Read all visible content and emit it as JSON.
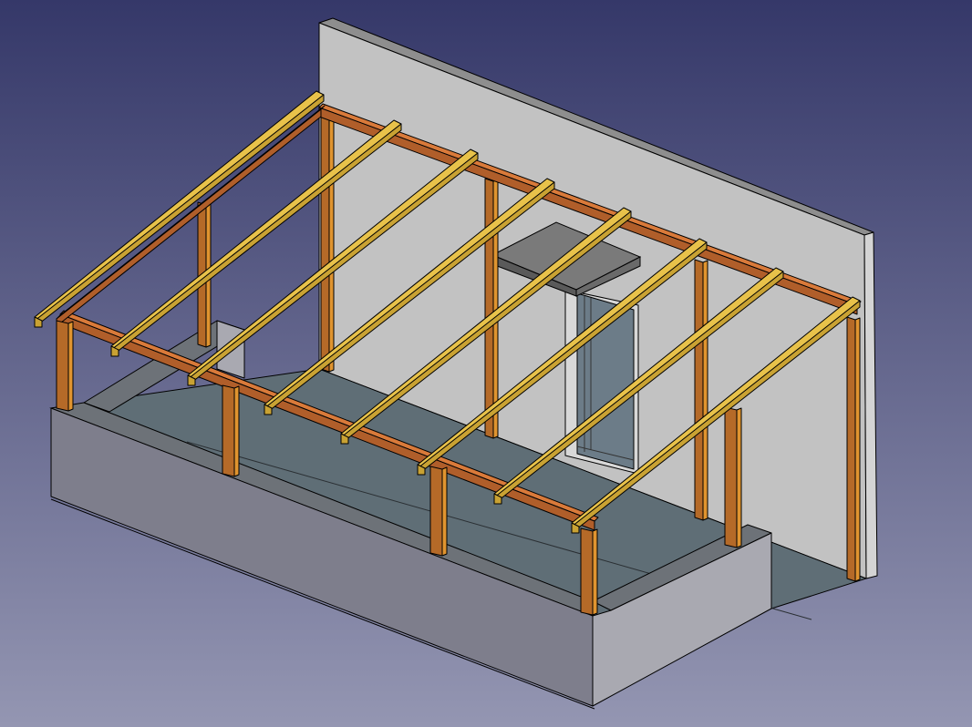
{
  "viewport": {
    "background_top": "#353869",
    "background_bottom": "#9496B2"
  },
  "model": {
    "colors": {
      "wall_face": "#C2C2C2",
      "wall_top": "#8E8E8E",
      "wall_side": "#D4D4D4",
      "floor": "#5F6E76",
      "base_front": "#7E7E8C",
      "base_top": "#6D7278",
      "base_side": "#A9A9B1",
      "door_recess": "#6C7C88",
      "lintel_top": "#7A7A7A",
      "lintel_front": "#5A5A5A",
      "beam_front": "#B05E2A",
      "beam_top": "#D97A3A",
      "post_front": "#B56A28",
      "post_side": "#E0942F",
      "rafter_top": "#E8C24A",
      "rafter_side": "#C9A233",
      "edge": "#000000"
    }
  }
}
